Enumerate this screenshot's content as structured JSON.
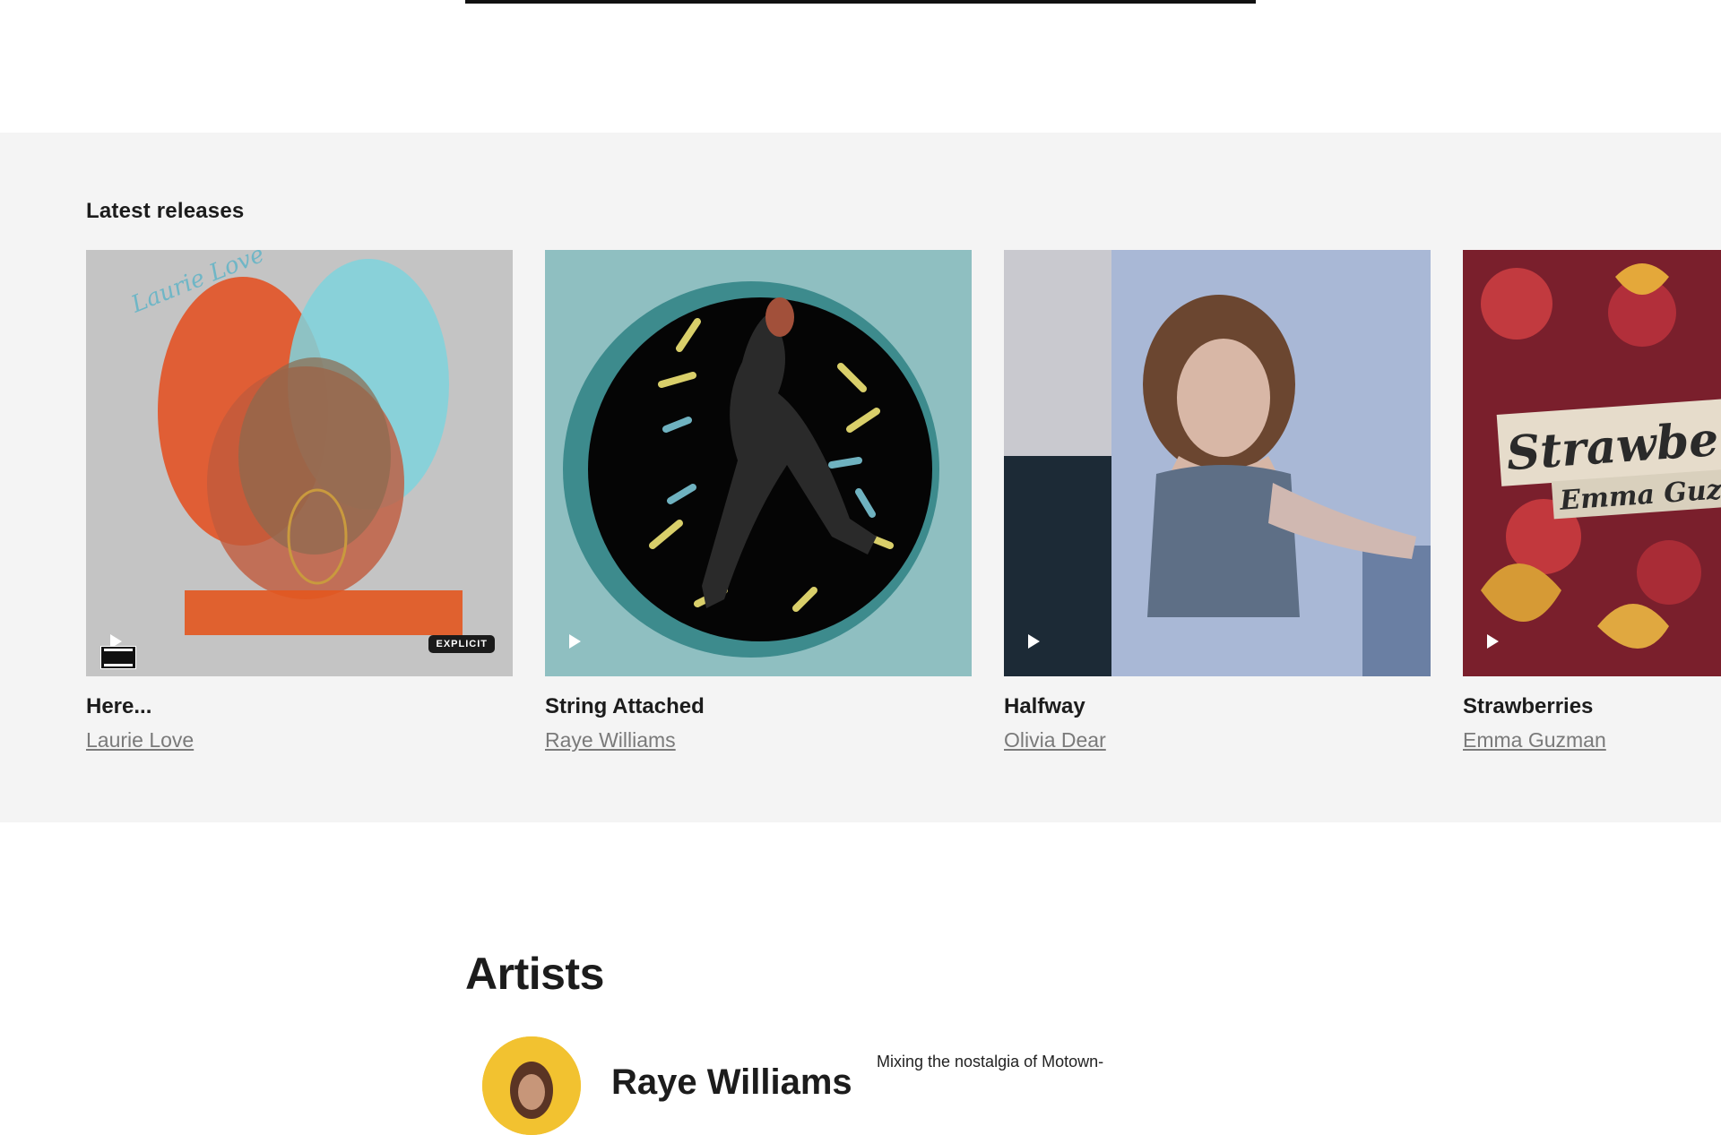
{
  "releases": {
    "heading": "Latest releases",
    "items": [
      {
        "title": "Here...",
        "artist": "Laurie Love",
        "explicit_label": "EXPLICIT",
        "cover_text": "Laurie Love"
      },
      {
        "title": "String Attached",
        "artist": "Raye Williams"
      },
      {
        "title": "Halfway",
        "artist": "Olivia Dear"
      },
      {
        "title": "Strawberries",
        "artist": "Emma Guzman",
        "cover_text": "Strawberries",
        "cover_subtext": "Emma Guzman"
      }
    ]
  },
  "artists": {
    "heading": "Artists",
    "featured": {
      "name": "Raye Williams",
      "bio": "Mixing the nostalgia of Motown-"
    }
  },
  "colors": {
    "section_bg": "#f4f4f4",
    "link_gray": "#7a7a7a",
    "avatar_bg": "#f2c230"
  },
  "icons": [
    "play-icon",
    "parental-advisory-icon"
  ]
}
